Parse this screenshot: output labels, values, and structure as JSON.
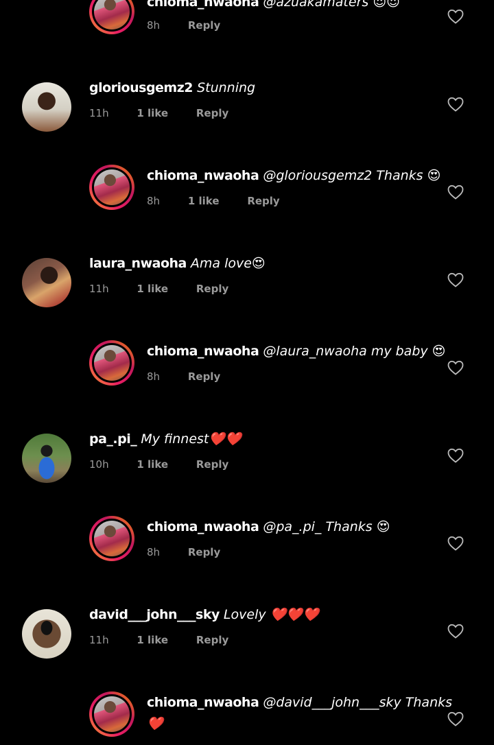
{
  "comments": [
    {
      "username": "chioma_nwaoha",
      "text": "@azuakamaters 😍😍",
      "time": "8h",
      "likes": "",
      "reply": "Reply"
    },
    {
      "username": "gloriousgemz2",
      "text": "Stunning",
      "time": "11h",
      "likes": "1 like",
      "reply": "Reply"
    },
    {
      "username": "chioma_nwaoha",
      "text": "@gloriousgemz2 Thanks 😍",
      "time": "8h",
      "likes": "1 like",
      "reply": "Reply"
    },
    {
      "username": "laura_nwaoha",
      "text": "Ama love😍",
      "time": "11h",
      "likes": "1 like",
      "reply": "Reply"
    },
    {
      "username": "chioma_nwaoha",
      "text": "@laura_nwaoha my baby 😍",
      "time": "8h",
      "likes": "",
      "reply": "Reply"
    },
    {
      "username": "pa_.pi_",
      "text": "My finnest❤️❤️",
      "time": "10h",
      "likes": "1 like",
      "reply": "Reply"
    },
    {
      "username": "chioma_nwaoha",
      "text": "@pa_.pi_ Thanks 😍",
      "time": "8h",
      "likes": "",
      "reply": "Reply"
    },
    {
      "username": "david___john___sky",
      "text": "Lovely ❤️❤️❤️",
      "time": "11h",
      "likes": "1 like",
      "reply": "Reply"
    },
    {
      "username": "chioma_nwaoha",
      "text": "@david___john___sky Thanks",
      "text2": "❤️",
      "time": "",
      "likes": "",
      "reply": ""
    }
  ],
  "icons": {
    "like": "heart-outline-icon"
  }
}
